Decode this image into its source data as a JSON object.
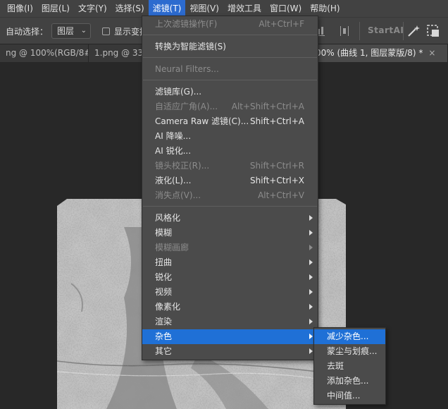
{
  "menubar": {
    "items": [
      {
        "label": "图像(I)"
      },
      {
        "label": "图层(L)"
      },
      {
        "label": "文字(Y)"
      },
      {
        "label": "选择(S)"
      },
      {
        "label": "滤镜(T)"
      },
      {
        "label": "视图(V)"
      },
      {
        "label": "增效工具"
      },
      {
        "label": "窗口(W)"
      },
      {
        "label": "帮助(H)"
      }
    ],
    "active": "滤镜(T)"
  },
  "options": {
    "auto_select_label": "自动选择：",
    "auto_select_value": "图层",
    "show_transform_label": "显示变换控件",
    "startai_label": "StartAI"
  },
  "tabs": [
    {
      "label": "ng @ 100%(RGB/8#)",
      "close": "×"
    },
    {
      "label": "1.png @ 33",
      "close": "×"
    },
    {
      "label": "00% (曲线 1, 图层蒙版/8) *",
      "close": "×"
    }
  ],
  "filter_menu": {
    "items": [
      {
        "label": "上次滤镜操作(F)",
        "shortcut": "Alt+Ctrl+F",
        "disabled": true
      },
      {
        "label": "转换为智能滤镜(S)",
        "shortcut": "",
        "disabled": false
      },
      {
        "label": "Neural Filters...",
        "shortcut": "",
        "disabled": true
      },
      {
        "label": "滤镜库(G)...",
        "shortcut": "",
        "disabled": false
      },
      {
        "label": "自适应广角(A)...",
        "shortcut": "Alt+Shift+Ctrl+A",
        "disabled": true
      },
      {
        "label": "Camera Raw 滤镜(C)...",
        "shortcut": "Shift+Ctrl+A",
        "disabled": false
      },
      {
        "label": "AI 降噪...",
        "shortcut": "",
        "disabled": false
      },
      {
        "label": "AI 锐化...",
        "shortcut": "",
        "disabled": false
      },
      {
        "label": "镜头校正(R)...",
        "shortcut": "Shift+Ctrl+R",
        "disabled": true
      },
      {
        "label": "液化(L)...",
        "shortcut": "Shift+Ctrl+X",
        "disabled": false
      },
      {
        "label": "消失点(V)...",
        "shortcut": "Alt+Ctrl+V",
        "disabled": true
      },
      {
        "label": "风格化",
        "submenu": true,
        "disabled": false
      },
      {
        "label": "模糊",
        "submenu": true,
        "disabled": false
      },
      {
        "label": "模糊画廊",
        "submenu": true,
        "disabled": true
      },
      {
        "label": "扭曲",
        "submenu": true,
        "disabled": false
      },
      {
        "label": "锐化",
        "submenu": true,
        "disabled": false
      },
      {
        "label": "视频",
        "submenu": true,
        "disabled": false
      },
      {
        "label": "像素化",
        "submenu": true,
        "disabled": false
      },
      {
        "label": "渲染",
        "submenu": true,
        "disabled": false
      },
      {
        "label": "杂色",
        "submenu": true,
        "disabled": false,
        "highlighted": true
      },
      {
        "label": "其它",
        "submenu": true,
        "disabled": false
      }
    ]
  },
  "noise_submenu": {
    "items": [
      {
        "label": "减少杂色...",
        "highlighted": true
      },
      {
        "label": "蒙尘与划痕..."
      },
      {
        "label": "去斑"
      },
      {
        "label": "添加杂色..."
      },
      {
        "label": "中间值..."
      }
    ]
  },
  "colors": {
    "menubar_bg": "#424242",
    "menu_bg": "#4b4b4b",
    "highlight": "#1f70d6",
    "active_menu": "#2c6bcf",
    "disabled_text": "#8c8c8c"
  }
}
